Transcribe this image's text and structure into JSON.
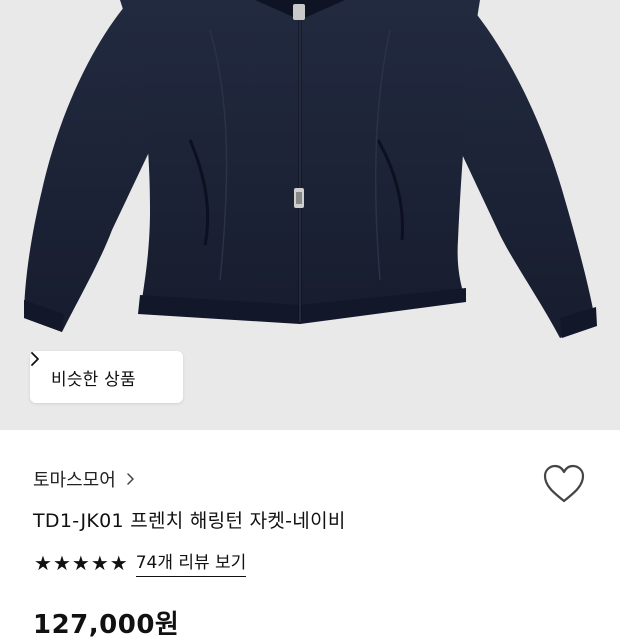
{
  "hero": {
    "background": "#e9e9e9",
    "jacket_color": "#1d2438"
  },
  "similar_button": {
    "label": "비슷한 상품",
    "icon": "chevron-right-icon"
  },
  "product": {
    "brand": "토마스모어",
    "name": "TD1-JK01 프렌치 해링턴 자켓-네이비",
    "rating_stars": 5,
    "reviews_link": "74개 리뷰 보기",
    "price": "127,000원",
    "wishlist_icon": "heart-outline-icon"
  }
}
